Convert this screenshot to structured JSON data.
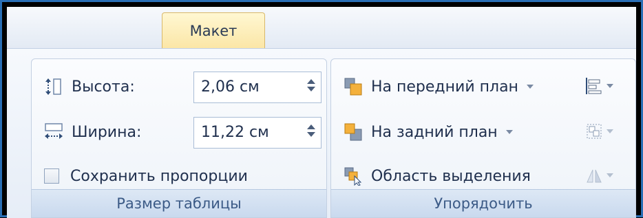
{
  "ribbon": {
    "active_tab": "Макет",
    "groups": {
      "table_size": {
        "label": "Размер таблицы",
        "height_label": "Высота:",
        "height_value": "2,06 см",
        "width_label": "Ширина:",
        "width_value": "11,22 см",
        "keep_ratio_label": "Сохранить пропорции"
      },
      "arrange": {
        "label": "Упорядочить",
        "bring_forward": "На передний план",
        "send_backward": "На задний план",
        "selection_pane": "Область выделения"
      }
    }
  },
  "icons": [
    "height-icon",
    "width-icon",
    "bring-forward-icon",
    "send-backward-icon",
    "selection-pane-icon",
    "align-icon",
    "group-icon",
    "rotate-icon"
  ]
}
